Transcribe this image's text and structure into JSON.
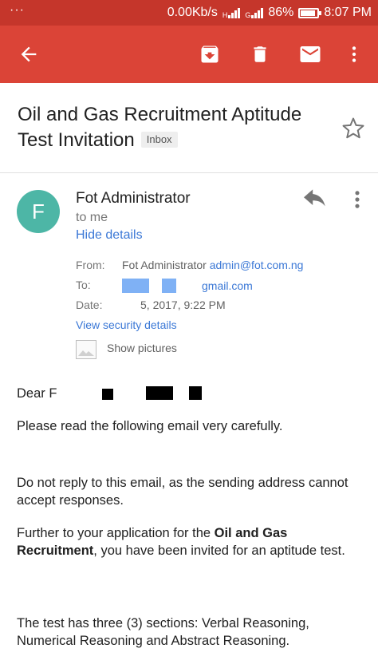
{
  "status_bar": {
    "menu_dots": "···",
    "network_speed": "0.00Kb/s",
    "signal1_label": "H",
    "signal2_label": "G",
    "battery": "86%",
    "battery_level": 0.86,
    "time": "8:07 PM"
  },
  "toolbar": {
    "back_icon": "arrow-back-icon",
    "archive_icon": "archive-icon",
    "delete_icon": "trash-icon",
    "mark_unread_icon": "mail-icon",
    "more_icon": "more-vert-icon"
  },
  "email": {
    "subject": "Oil and Gas Recruitment Aptitude Test Invitation",
    "label": "Inbox",
    "sender_initial": "F",
    "sender_name": "Fot Administrator",
    "to_me": "to me",
    "hide_details": "Hide details",
    "details": {
      "from_label": "From:",
      "from_name": "Fot Administrator",
      "from_email": "admin@fot.com.ng",
      "to_label": "To:",
      "to_value": "gmail.com",
      "date_label": "Date:",
      "date_value": "5, 2017, 9:22 PM"
    },
    "view_security": "View security details",
    "show_pictures": "Show pictures",
    "body": {
      "greeting": "Dear F",
      "line1": "Please read the following email very carefully.",
      "line2": "Do not reply to this email, as the sending address cannot accept responses.",
      "para3_before": "Further to your application for the ",
      "para3_bold": "Oil and Gas Recruitment",
      "para3_after": ", you have been invited for an aptitude test.",
      "line4": "The test has three (3) sections: Verbal Reasoning, Numerical Reasoning and Abstract Reasoning."
    }
  },
  "colors": {
    "status_bar": "#c5362b",
    "app_bar": "#db4437",
    "avatar": "#4db6a6",
    "link": "#3b78d6"
  }
}
